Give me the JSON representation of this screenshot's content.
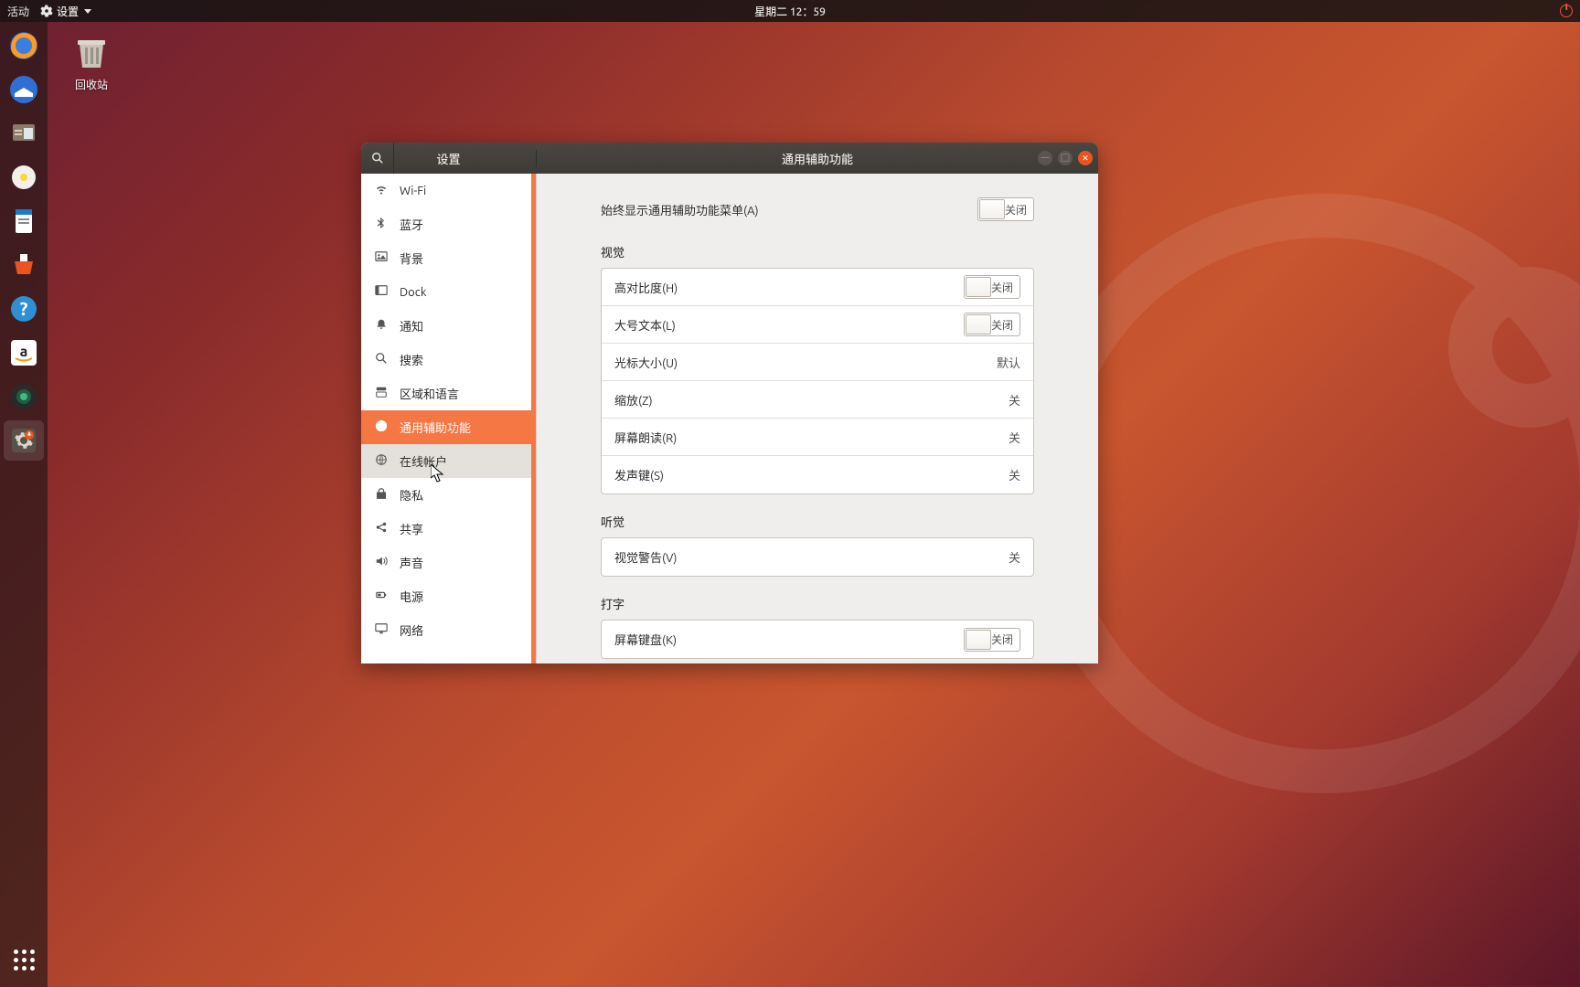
{
  "topbar": {
    "activities": "活动",
    "app": "设置",
    "datetime": "星期二 12：59"
  },
  "desktop": {
    "trash_label": "回收站"
  },
  "dock": {
    "items": [
      {
        "name": "firefox"
      },
      {
        "name": "thunderbird"
      },
      {
        "name": "files"
      },
      {
        "name": "rhythmbox"
      },
      {
        "name": "writer"
      },
      {
        "name": "software"
      },
      {
        "name": "help"
      },
      {
        "name": "amazon"
      },
      {
        "name": "camera"
      },
      {
        "name": "settings-tweak"
      }
    ]
  },
  "window": {
    "sidebar_title": "设置",
    "content_title": "通用辅助功能",
    "sidebar": [
      {
        "icon": "wifi",
        "label": "Wi-Fi"
      },
      {
        "icon": "bluetooth",
        "label": "蓝牙"
      },
      {
        "icon": "background",
        "label": "背景"
      },
      {
        "icon": "dock",
        "label": "Dock"
      },
      {
        "icon": "bell",
        "label": "通知"
      },
      {
        "icon": "search",
        "label": "搜索"
      },
      {
        "icon": "region",
        "label": "区域和语言"
      },
      {
        "icon": "a11y",
        "label": "通用辅助功能"
      },
      {
        "icon": "accounts",
        "label": "在线帐户"
      },
      {
        "icon": "privacy",
        "label": "隐私"
      },
      {
        "icon": "share",
        "label": "共享"
      },
      {
        "icon": "sound",
        "label": "声音"
      },
      {
        "icon": "power",
        "label": "电源"
      },
      {
        "icon": "network",
        "label": "网络"
      }
    ],
    "content": {
      "always_show_menu": {
        "label": "始终显示通用辅助功能菜单(A)",
        "switch": "关闭"
      },
      "sections": [
        {
          "heading": "视觉",
          "rows": [
            {
              "label": "高对比度(H)",
              "type": "switch",
              "value": "关闭"
            },
            {
              "label": "大号文本(L)",
              "type": "switch",
              "value": "关闭"
            },
            {
              "label": "光标大小(U)",
              "type": "nav",
              "value": "默认"
            },
            {
              "label": "缩放(Z)",
              "type": "nav",
              "value": "关"
            },
            {
              "label": "屏幕朗读(R)",
              "type": "nav",
              "value": "关"
            },
            {
              "label": "发声键(S)",
              "type": "nav",
              "value": "关"
            }
          ]
        },
        {
          "heading": "听觉",
          "rows": [
            {
              "label": "视觉警告(V)",
              "type": "nav",
              "value": "关"
            }
          ]
        },
        {
          "heading": "打字",
          "rows": [
            {
              "label": "屏幕键盘(K)",
              "type": "switch",
              "value": "关闭"
            }
          ]
        }
      ]
    }
  }
}
